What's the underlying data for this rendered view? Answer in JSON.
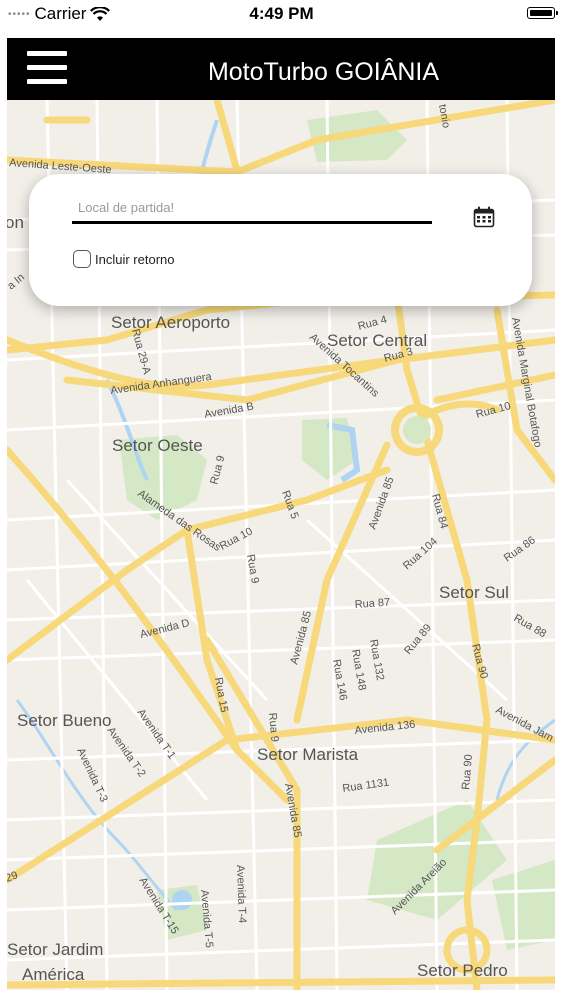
{
  "status_bar": {
    "carrier": "Carrier",
    "time": "4:49 PM",
    "dots": "•••••"
  },
  "app_bar": {
    "title": "MotoTurbo GOIÂNIA",
    "menu_icon": "hamburger-menu-icon"
  },
  "search_card": {
    "departure_placeholder": "Local de partida!",
    "departure_value": "",
    "calendar_icon": "calendar-icon",
    "include_return_label": "Incluir retorno",
    "include_return_checked": false
  },
  "map": {
    "colors": {
      "background": "#f2efe9",
      "major_road": "#f7d87a",
      "minor_road": "#ffffff",
      "park": "#d4e8c5",
      "water": "#aed4f2"
    },
    "districts": {
      "aeroporto": "Setor Aeroporto",
      "central": "Setor Central",
      "oeste": "Setor Oeste",
      "sul": "Setor Sul",
      "bueno": "Setor Bueno",
      "marista": "Setor Marista",
      "jardim_america_line1": "Setor Jardim",
      "jardim_america_line2": "América",
      "pedro": "Setor Pedro",
      "cut_left": "on",
      "cut_left_2": "a In"
    },
    "streets": {
      "leste_oeste": "Avenida Leste-Oeste",
      "anhanguera": "Avenida Anhanguera",
      "avenida_b": "Avenida B",
      "alameda_rosas": "Alameda das Rosas",
      "rua_29a": "Rua 29-A",
      "rua_4": "Rua 4",
      "rua_3": "Rua 3",
      "tocantins": "Avenida Tocantins",
      "rua_10_east": "Rua 10",
      "marginal_botafogo": "Avenida Marginal Botafogo",
      "rua_9": "Rua 9",
      "rua_5": "Rua 5",
      "rua_10": "Rua 10",
      "rua_9_b": "Rua 9",
      "av_85": "Avenida 85",
      "av_85_b": "Avenida 85",
      "av_85_c": "Avenida 85",
      "rua_84": "Rua 84",
      "rua_104": "Rua 104",
      "rua_86": "Rua 86",
      "rua_87": "Rua 87",
      "rua_88": "Rua 88",
      "rua_89": "Rua 89",
      "avenida_d": "Avenida D",
      "rua_132": "Rua 132",
      "rua_148": "Rua 148",
      "rua_146": "Rua 146",
      "rua_90": "Rua 90",
      "rua_90_b": "Rua 90",
      "rua_15": "Rua 15",
      "av_136": "Avenida 136",
      "av_jam": "Avenida Jam",
      "av_t1": "Avenida T-1",
      "av_t2": "Avenida T-2",
      "av_t3": "Avenida T-3",
      "rua_1131": "Rua 1131",
      "rua_9_c": "Rua 9",
      "av_areiao": "Avenida Areião",
      "av_t4": "Avenida T-4",
      "av_t5": "Avenida T-5",
      "av_t15": "Avenida T-15",
      "rua_29_cut": "29",
      "tonio": "tonio"
    }
  }
}
